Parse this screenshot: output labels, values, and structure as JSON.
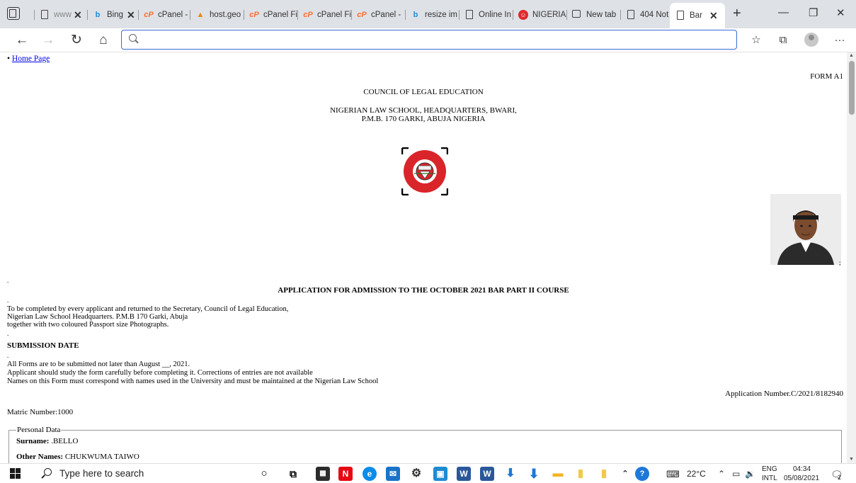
{
  "browser": {
    "tabs": [
      {
        "icon": "page-icon",
        "title": "www",
        "closable": true
      },
      {
        "icon": "bing-icon",
        "title": "Bing",
        "closable": true
      },
      {
        "icon": "cpanel-icon",
        "title": "cPanel -"
      },
      {
        "icon": "host-icon",
        "title": "host.geo"
      },
      {
        "icon": "cpanel-icon",
        "title": "cPanel Fi"
      },
      {
        "icon": "cpanel-icon",
        "title": "cPanel Fi"
      },
      {
        "icon": "cpanel-icon",
        "title": "cPanel -"
      },
      {
        "icon": "bing-icon",
        "title": "resize im"
      },
      {
        "icon": "page-icon",
        "title": "Online In"
      },
      {
        "icon": "red-circle-icon",
        "title": "NIGERIA"
      },
      {
        "icon": "newtab-icon",
        "title": "New tab"
      },
      {
        "icon": "page-icon",
        "title": "404 Not"
      },
      {
        "icon": "page-icon",
        "title": "Bar",
        "active": true,
        "closable": true
      }
    ],
    "address": {
      "value": "",
      "placeholder": ""
    }
  },
  "page": {
    "home_link": "Home Page",
    "form_id": "FORM A1",
    "council": "COUNCIL OF LEGAL EDUCATION",
    "school_line1": "NIGERIAN LAW SCHOOL, HEADQUARTERS, BWARI,",
    "school_line2": "P.M.B. 170 GARKI, ABUJA NIGERIA",
    "seal_text": "COUNCIL OF LEGAL EDUCATION",
    "dot": ".",
    "semicolon": ";",
    "heading": "APPLICATION FOR ADMISSION TO THE OCTOBER 2021 BAR PART II COURSE",
    "instructions": [
      "To be completed by every applicant and returned to the Secretary, Council of Legal Education,",
      "Nigerian Law School Headquarters. P.M.B 170 Garki, Abuja",
      "together with two coloured Passport size Photographs."
    ],
    "submission_title": "SUBMISSION DATE",
    "submission_notes": [
      "All Forms are to be submitted not later than August __, 2021.",
      "Applicant should study the form carefully before completing it. Corrections of entries are not available",
      "Names on this Form must correspond with names used in the University and must be maintained at the Nigerian Law School"
    ],
    "application_number": "Application Number.C/2021/8182940",
    "matric_number": "Matric Number:1000",
    "personal_data": {
      "legend": "Personal Data",
      "surname_label": "Surname:",
      "surname_value": " .BELLO",
      "other_names_label": "Other Names:",
      "other_names_value": " CHUKWUMA TAIWO"
    }
  },
  "taskbar": {
    "search_placeholder": "Type here to search",
    "temperature": "22°C",
    "language_line1": "ENG",
    "language_line2": "INTL",
    "time": "04:34",
    "date": "05/08/2021",
    "notification_count": "2"
  }
}
